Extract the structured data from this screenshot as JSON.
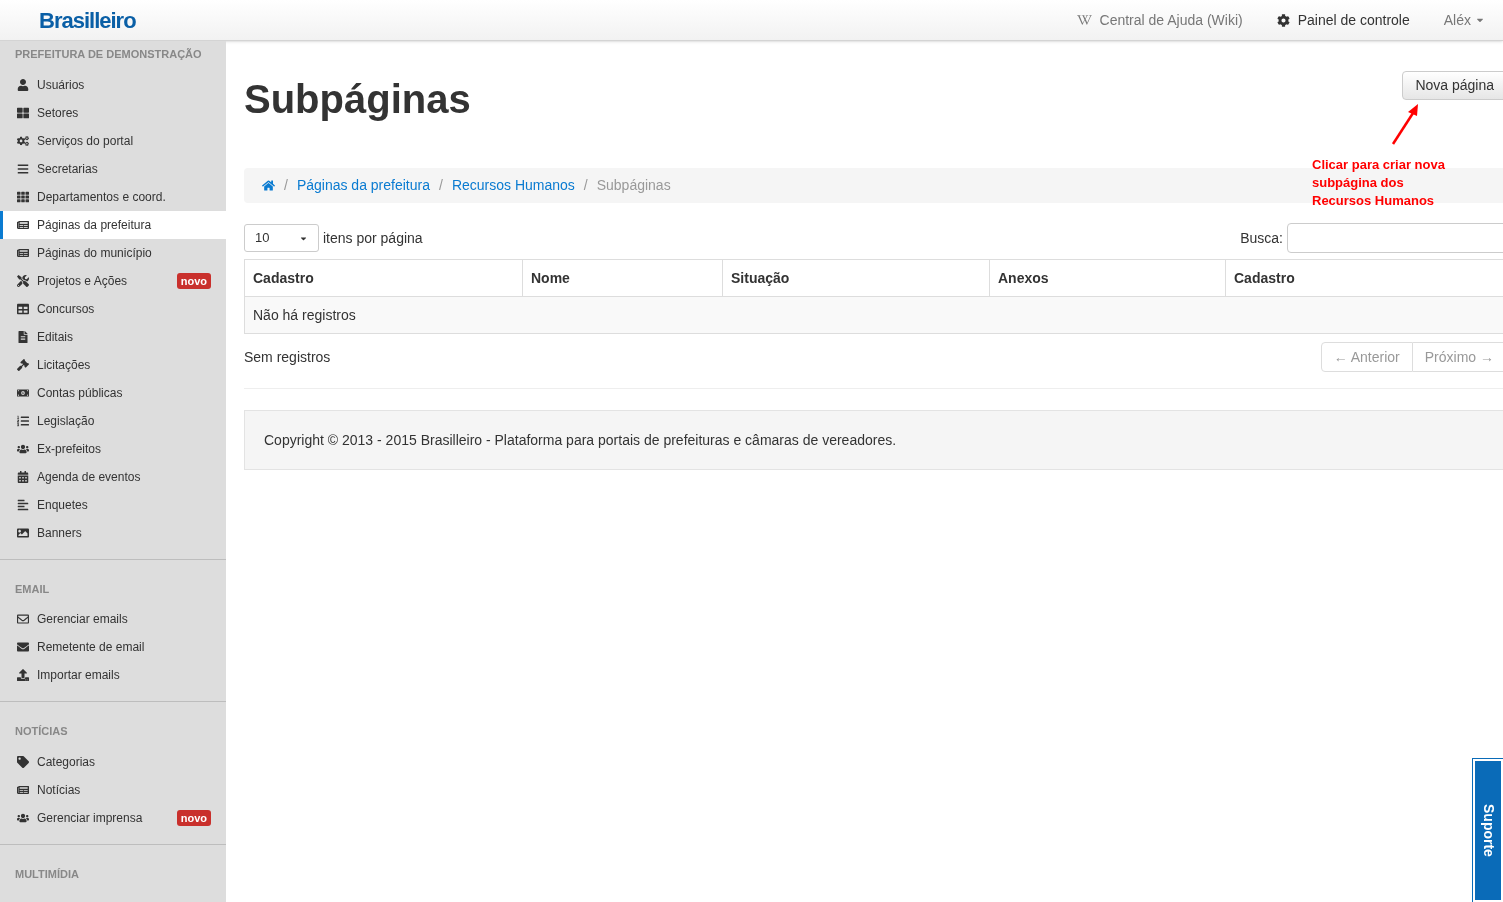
{
  "header": {
    "logo": "Brasilleiro",
    "links": [
      {
        "kind": "wiki",
        "label": "Central de Ajuda (Wiki)"
      },
      {
        "kind": "gear",
        "label": "Painel de controle"
      },
      {
        "kind": "user",
        "label": "Aléx"
      }
    ]
  },
  "sidebar": {
    "sections": [
      {
        "title": "PREFEITURA DE DEMONSTRAÇÃO",
        "items": [
          {
            "label": "Usuários",
            "selected": false
          },
          {
            "label": "Setores",
            "selected": false
          },
          {
            "label": "Serviços do portal",
            "selected": false
          },
          {
            "label": "Secretarias",
            "selected": false
          },
          {
            "label": "Departamentos e coord.",
            "selected": false
          },
          {
            "label": "Páginas da prefeitura",
            "selected": true
          },
          {
            "label": "Páginas do município",
            "selected": false
          },
          {
            "label": "Projetos e Ações",
            "selected": false,
            "badge": "novo"
          },
          {
            "label": "Concursos",
            "selected": false
          },
          {
            "label": "Editais",
            "selected": false
          },
          {
            "label": "Licitações",
            "selected": false
          },
          {
            "label": "Contas públicas",
            "selected": false
          },
          {
            "label": "Legislação",
            "selected": false
          },
          {
            "label": "Ex-prefeitos",
            "selected": false
          },
          {
            "label": "Agenda de eventos",
            "selected": false
          },
          {
            "label": "Enquetes",
            "selected": false
          },
          {
            "label": "Banners",
            "selected": false
          }
        ]
      },
      {
        "title": "EMAIL",
        "items": [
          {
            "label": "Gerenciar emails",
            "selected": false
          },
          {
            "label": "Remetente de email",
            "selected": false
          },
          {
            "label": "Importar emails",
            "selected": false
          }
        ]
      },
      {
        "title": "NOTÍCIAS",
        "items": [
          {
            "label": "Categorias",
            "selected": false
          },
          {
            "label": "Notícias",
            "selected": false
          },
          {
            "label": "Gerenciar imprensa",
            "selected": false,
            "badge": "novo"
          }
        ]
      },
      {
        "title": "MULTIMÍDIA"
      }
    ]
  },
  "page": {
    "title": "Subpáginas",
    "new_button": "Nova página",
    "annotation": "Clicar para criar nova subpágina dos Recursos Humanos",
    "breadcrumb": [
      "Páginas da prefeitura",
      "Recursos Humanos",
      "Subpáginas"
    ],
    "breadcrumb_separators": [
      "/",
      "/",
      "/"
    ],
    "per_page": {
      "value": "10",
      "label": "itens por página"
    },
    "search": {
      "label": "Busca:"
    },
    "table": {
      "columns": [
        "Cadastro",
        "Nome",
        "Situação",
        "Anexos",
        "Cadastro"
      ],
      "empty": "Não há registros"
    },
    "info": "Sem registros",
    "pager": [
      {
        "label": "← Anterior",
        "disabled": true
      },
      {
        "label": "Próximo →",
        "disabled": true
      }
    ],
    "footer": "Copyright © 2013 - 2015 Brasilleiro - Plataforma para portais de prefeituras e câmaras de vereadores.",
    "support": "Suporte"
  }
}
